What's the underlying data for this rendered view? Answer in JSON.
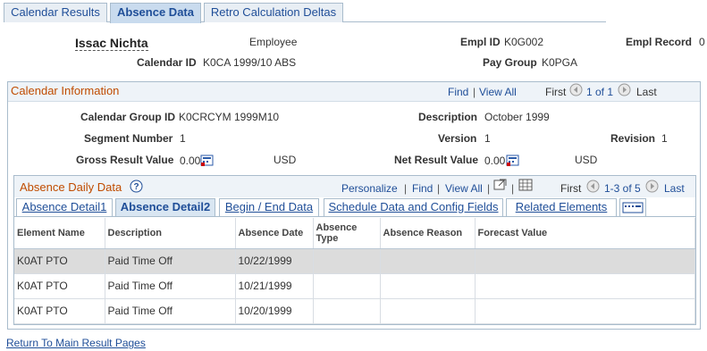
{
  "top_tabs": [
    "Calendar Results",
    "Absence Data",
    "Retro Calculation Deltas"
  ],
  "employee": {
    "name": "Issac Nichta",
    "role": "Employee",
    "empl_id_label": "Empl ID",
    "empl_id": "K0G002",
    "empl_record_label": "Empl Record",
    "empl_record": "0",
    "calendar_id_label": "Calendar ID",
    "calendar_id": "K0CA 1999/10 ABS",
    "pay_group_label": "Pay Group",
    "pay_group": "K0PGA"
  },
  "calendar_info": {
    "title": "Calendar Information",
    "find": "Find",
    "sep": "|",
    "view_all": "View All",
    "first": "First",
    "range": "1 of 1",
    "last": "Last",
    "calendar_group_id_label": "Calendar Group ID",
    "calendar_group_id": "K0CRCYM 1999M10",
    "description_label": "Description",
    "description": "October 1999",
    "segment_number_label": "Segment Number",
    "segment_number": "1",
    "version_label": "Version",
    "version": "1",
    "revision_label": "Revision",
    "revision": "1",
    "gross_result_label": "Gross Result Value",
    "gross_result": "0.00",
    "gross_currency": "USD",
    "net_result_label": "Net Result Value",
    "net_result": "0.00",
    "net_currency": "USD"
  },
  "absence_grid": {
    "title": "Absence Daily Data",
    "personalize": "Personalize",
    "find": "Find",
    "view_all": "View All",
    "sep": "|",
    "first": "First",
    "range": "1-3 of 5",
    "last": "Last",
    "tabs": [
      "Absence Detail1",
      "Absence Detail2",
      "Begin / End Data",
      "Schedule Data and Config Fields",
      "Related Elements"
    ],
    "columns": [
      "Element Name",
      "Description",
      "Absence Date",
      "Absence Type",
      "Absence Reason",
      "Forecast Value"
    ],
    "rows": [
      {
        "element": "K0AT PTO",
        "description": "Paid Time Off",
        "date": "10/22/1999",
        "type": "",
        "reason": "",
        "forecast": ""
      },
      {
        "element": "K0AT PTO",
        "description": "Paid Time Off",
        "date": "10/21/1999",
        "type": "",
        "reason": "",
        "forecast": ""
      },
      {
        "element": "K0AT PTO",
        "description": "Paid Time Off",
        "date": "10/20/1999",
        "type": "",
        "reason": "",
        "forecast": ""
      }
    ]
  },
  "footer_link": "Return To Main Result Pages",
  "colors": {
    "link": "#1f4e98",
    "section_title": "#c04c00",
    "border": "#a9bccc"
  }
}
